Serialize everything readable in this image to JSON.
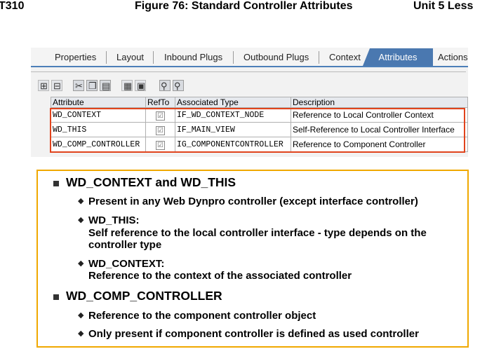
{
  "header": {
    "left": "T310",
    "center": "Figure 76: Standard Controller Attributes",
    "right": "Unit 5 Less"
  },
  "tabs": [
    "Properties",
    "Layout",
    "Inbound Plugs",
    "Outbound Plugs",
    "Context",
    "Attributes",
    "Actions"
  ],
  "active_tab": "Attributes",
  "table": {
    "headers": [
      "Attribute",
      "RefTo",
      "Associated Type",
      "Description"
    ],
    "rows": [
      {
        "attribute": "WD_CONTEXT",
        "refto": "☑",
        "type": "IF_WD_CONTEXT_NODE",
        "description": "Reference to Local Controller Context"
      },
      {
        "attribute": "WD_THIS",
        "refto": "☑",
        "type": "IF_MAIN_VIEW",
        "description": "Self-Reference to Local Controller Interface"
      },
      {
        "attribute": "WD_COMP_CONTROLLER",
        "refto": "☑",
        "type": "IG_COMPONENTCONTROLLER",
        "description": "Reference to Component Controller"
      }
    ]
  },
  "bullets": {
    "b1": {
      "title": "WD_CONTEXT and WD_THIS",
      "s1": "Present in any Web Dynpro controller (except interface controller)",
      "s2_l1": "WD_THIS:",
      "s2_l2": "Self reference to the local controller interface - type depends on the",
      "s2_l3": "controller type",
      "s3_l1": "WD_CONTEXT:",
      "s3_l2": "Reference to the context of the associated controller"
    },
    "b2": {
      "title": "WD_COMP_CONTROLLER",
      "s1": "Reference to the component controller object",
      "s2": "Only present if component controller is defined as used controller"
    }
  },
  "icons": {
    "bullet_square": "square-bullet-icon",
    "sub_bullet": "diamond-bullet-icon",
    "checkbox": "checkbox-checked-icon"
  },
  "colors": {
    "tab_active": "#4a78b0",
    "highlight_box": "#e1431c",
    "info_border": "#f0a800"
  }
}
